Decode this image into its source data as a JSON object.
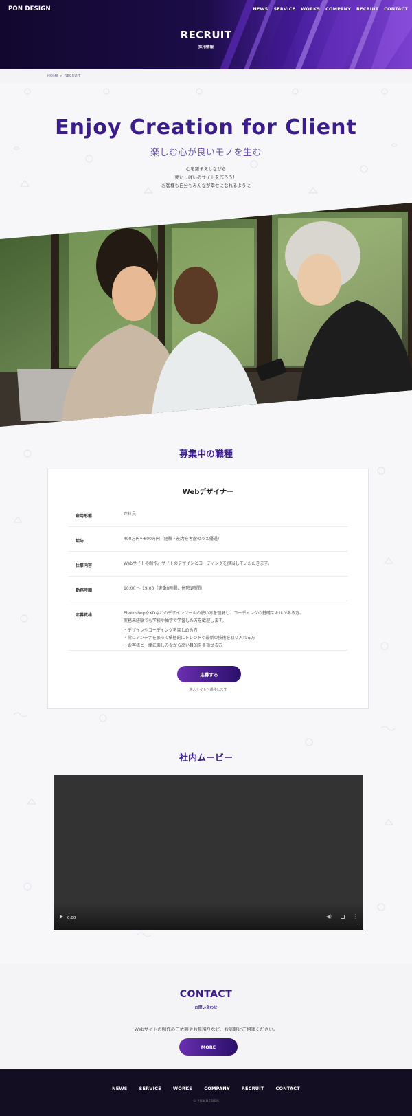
{
  "header": {
    "logo": "PON DESIGN",
    "nav": [
      "NEWS",
      "SERVICE",
      "WORKS",
      "COMPANY",
      "RECRUIT",
      "CONTACT"
    ],
    "title": "RECRUIT",
    "subtitle": "採用情報"
  },
  "breadcrumb": "HOME > RECRUIT",
  "intro": {
    "title": "Enjoy Creation for Client",
    "subtitle": "楽しむ心が良いモノを生む",
    "lines": [
      "心を躍まえしながら",
      "夢いっぱいのサイトを作ろう！",
      "お客様も自分もみんなが幸せになれるように"
    ]
  },
  "jobs": {
    "section_title": "募集中の職種",
    "job_title": "Webデザイナー",
    "rows": [
      {
        "label": "雇用形態",
        "value": "正社員"
      },
      {
        "label": "給与",
        "value": "400万円〜600万円（経験・能力を考慮のうえ優遇）"
      },
      {
        "label": "仕事内容",
        "value": "Webサイトの制作。サイトのデザインとコーディングを担当していただきます。"
      },
      {
        "label": "勤務時間",
        "value": "10:00 〜 19:00（実働8時間、休憩1時間）"
      },
      {
        "label": "応募資格",
        "value": "PhotoshopやXDなどのデザインツールの使い方を理解し、コーディングの基礎スキルがある方。",
        "value2": "実務未経験でも学校や独学で学習した方を歓迎します。",
        "bullets": [
          "・デザインやコーディングを楽しめる方",
          "・常にアンテナを張って積極的にトレンドや最新の技術を取り入れる方",
          "・お客様と一緒に楽しみながら高い目的を目指せる方"
        ]
      }
    ],
    "apply_label": "応募する",
    "apply_note": "求人サイトへ遷移します"
  },
  "movie": {
    "section_title": "社内ムービー",
    "time": "0:00"
  },
  "contact": {
    "title": "CONTACT",
    "subtitle": "お問い合わせ",
    "text": "Webサイトの制作のご依頼やお見積りなど、お気軽にご相談ください。",
    "button": "MORE"
  },
  "footer": {
    "nav": [
      "NEWS",
      "SERVICE",
      "WORKS",
      "COMPANY",
      "RECRUIT",
      "CONTACT"
    ],
    "copyright": "© PON DESIGN"
  }
}
